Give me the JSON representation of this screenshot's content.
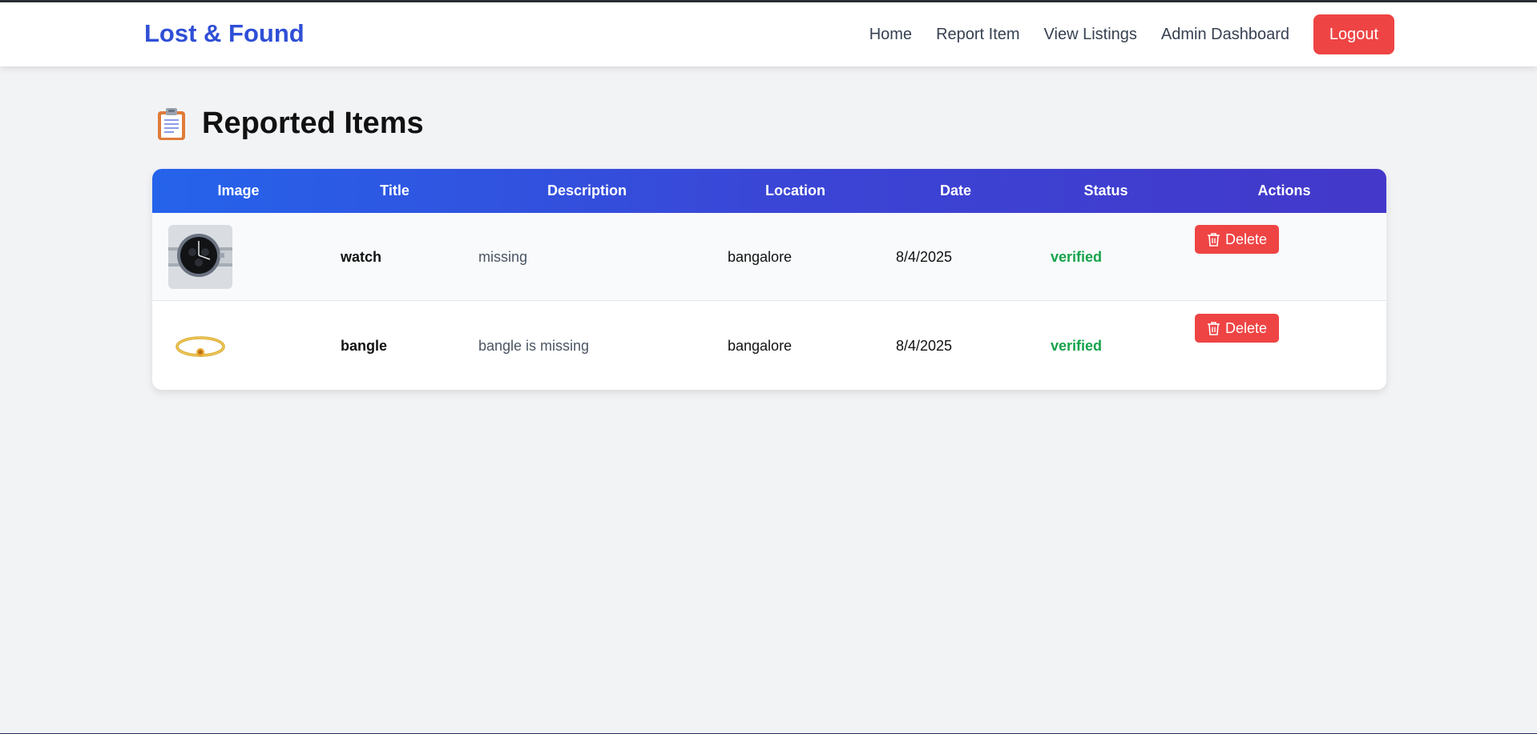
{
  "navbar": {
    "brand": "Lost & Found",
    "links": [
      "Home",
      "Report Item",
      "View Listings",
      "Admin Dashboard"
    ],
    "logout_label": "Logout",
    "brand_color": "#2f4fd6",
    "logout_color": "#ef4444"
  },
  "page": {
    "heading_icon": "clipboard-icon",
    "title": "Reported Items"
  },
  "table": {
    "columns": [
      "Image",
      "Title",
      "Description",
      "Location",
      "Date",
      "Status",
      "Actions"
    ],
    "rows": [
      {
        "image": "watch-thumbnail",
        "title": "watch",
        "description": "missing",
        "location": "bangalore",
        "date": "8/4/2025",
        "status": "verified",
        "action_label": "Delete"
      },
      {
        "image": "bangle-thumbnail",
        "title": "bangle",
        "description": "bangle is missing",
        "location": "bangalore",
        "date": "8/4/2025",
        "status": "verified",
        "action_label": "Delete"
      }
    ],
    "header_gradient": [
      "#2563eb",
      "#4338ca"
    ],
    "status_color": "#16a34a",
    "delete_color": "#ef4444"
  }
}
